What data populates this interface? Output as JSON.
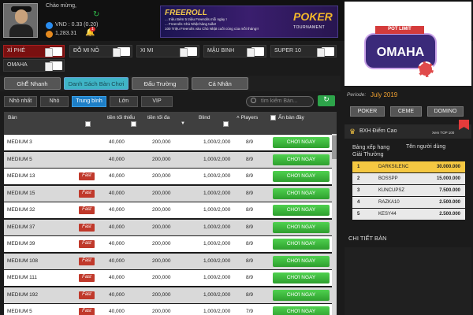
{
  "header": {
    "greeting": "Chào mừng,",
    "vnd": "VND : 0.33 (0.20)",
    "chips": "1,283.31",
    "bell_count": "1",
    "banner": {
      "title": "FREEROLL",
      "lines": [
        "... triệu Bẻm 5 triệu Freerolls mỗi ngày !",
        "... Freerolls Chủ Nhật hàng tuần!",
        "100 Triệu Freerolls vào Chủ Nhật cuối cùng của mỗi tháng!!"
      ],
      "brand": "POKER",
      "brand_sub": "TOURNAMENT"
    }
  },
  "game_tabs": [
    "XÌ PHÉ",
    "ĐỖ MI NÔ",
    "XI MI",
    "MẬU BINH",
    "SUPER 10",
    "OMAHA"
  ],
  "lobby_tabs": [
    "GhẾ Nhanh",
    "Danh Sách Bàn Chơi",
    "Đấu Trường",
    "Cá Nhân"
  ],
  "filter_tabs": [
    "Nhỏ nhất",
    "Nhỏ",
    "Trung bình",
    "Lớn",
    "VIP"
  ],
  "search_placeholder": "tìm kiếm Bàn...",
  "table": {
    "headers": {
      "room": "Bàn",
      "min": "tiền tối thiểu",
      "max": "tiền tối đa",
      "blind": "Blind",
      "players": "Players",
      "hide_full": "Ẩn bàn đầy"
    },
    "fast_label": "Fast",
    "play_label": "CHƠI NGAY",
    "rows": [
      {
        "name": "MEDIUM 3",
        "min": "40,000",
        "max": "200,000",
        "blind": "1,000/2,000",
        "players": "8/9",
        "fast": false
      },
      {
        "name": "MEDIUM 5",
        "min": "40,000",
        "max": "200,000",
        "blind": "1,000/2,000",
        "players": "8/9",
        "fast": false
      },
      {
        "name": "MEDIUM 13",
        "min": "40,000",
        "max": "200,000",
        "blind": "1,000/2,000",
        "players": "8/9",
        "fast": true
      },
      {
        "name": "MEDIUM 15",
        "min": "40,000",
        "max": "200,000",
        "blind": "1,000/2,000",
        "players": "8/9",
        "fast": true
      },
      {
        "name": "MEDIUM 32",
        "min": "40,000",
        "max": "200,000",
        "blind": "1,000/2,000",
        "players": "8/9",
        "fast": true
      },
      {
        "name": "MEDIUM 37",
        "min": "40,000",
        "max": "200,000",
        "blind": "1,000/2,000",
        "players": "8/9",
        "fast": true
      },
      {
        "name": "MEDIUM 39",
        "min": "40,000",
        "max": "200,000",
        "blind": "1,000/2,000",
        "players": "8/9",
        "fast": true
      },
      {
        "name": "MEDIUM 108",
        "min": "40,000",
        "max": "200,000",
        "blind": "1,000/2,000",
        "players": "8/9",
        "fast": true
      },
      {
        "name": "MEDIUM 111",
        "min": "40,000",
        "max": "200,000",
        "blind": "1,000/2,000",
        "players": "8/9",
        "fast": true
      },
      {
        "name": "MEDIUM 192",
        "min": "40,000",
        "max": "200,000",
        "blind": "1,000/2,000",
        "players": "8/9",
        "fast": true
      },
      {
        "name": "MEDIUM 5",
        "min": "40,000",
        "max": "200,000",
        "blind": "1,000/2,000",
        "players": "7/9",
        "fast": true
      }
    ]
  },
  "ad": {
    "pot_limit": "POT LIMIT",
    "title": "OMAHA"
  },
  "period": {
    "label": "Periode:",
    "value": "July 2019"
  },
  "right_tabs": [
    "POKER",
    "CEME",
    "DOMINO"
  ],
  "leaderboard": {
    "title": "BXH Điểm Cao",
    "subtitle": "Xem TOP 100",
    "col_rank": "Bảng xếp hạng Giải Thưởng",
    "col_name": "Tên người dùng",
    "rows": [
      {
        "rank": "1",
        "name": "DARKSILENC",
        "points": "30.000.000"
      },
      {
        "rank": "2",
        "name": "BOSSPP",
        "points": "15.000.000"
      },
      {
        "rank": "3",
        "name": "KUNCUPSZ",
        "points": "7.500.000"
      },
      {
        "rank": "4",
        "name": "RAZKA10",
        "points": "2.500.000"
      },
      {
        "rank": "5",
        "name": "KESY44",
        "points": "2.500.000"
      }
    ]
  },
  "detail_label": "CHI TIẾT BÀN"
}
